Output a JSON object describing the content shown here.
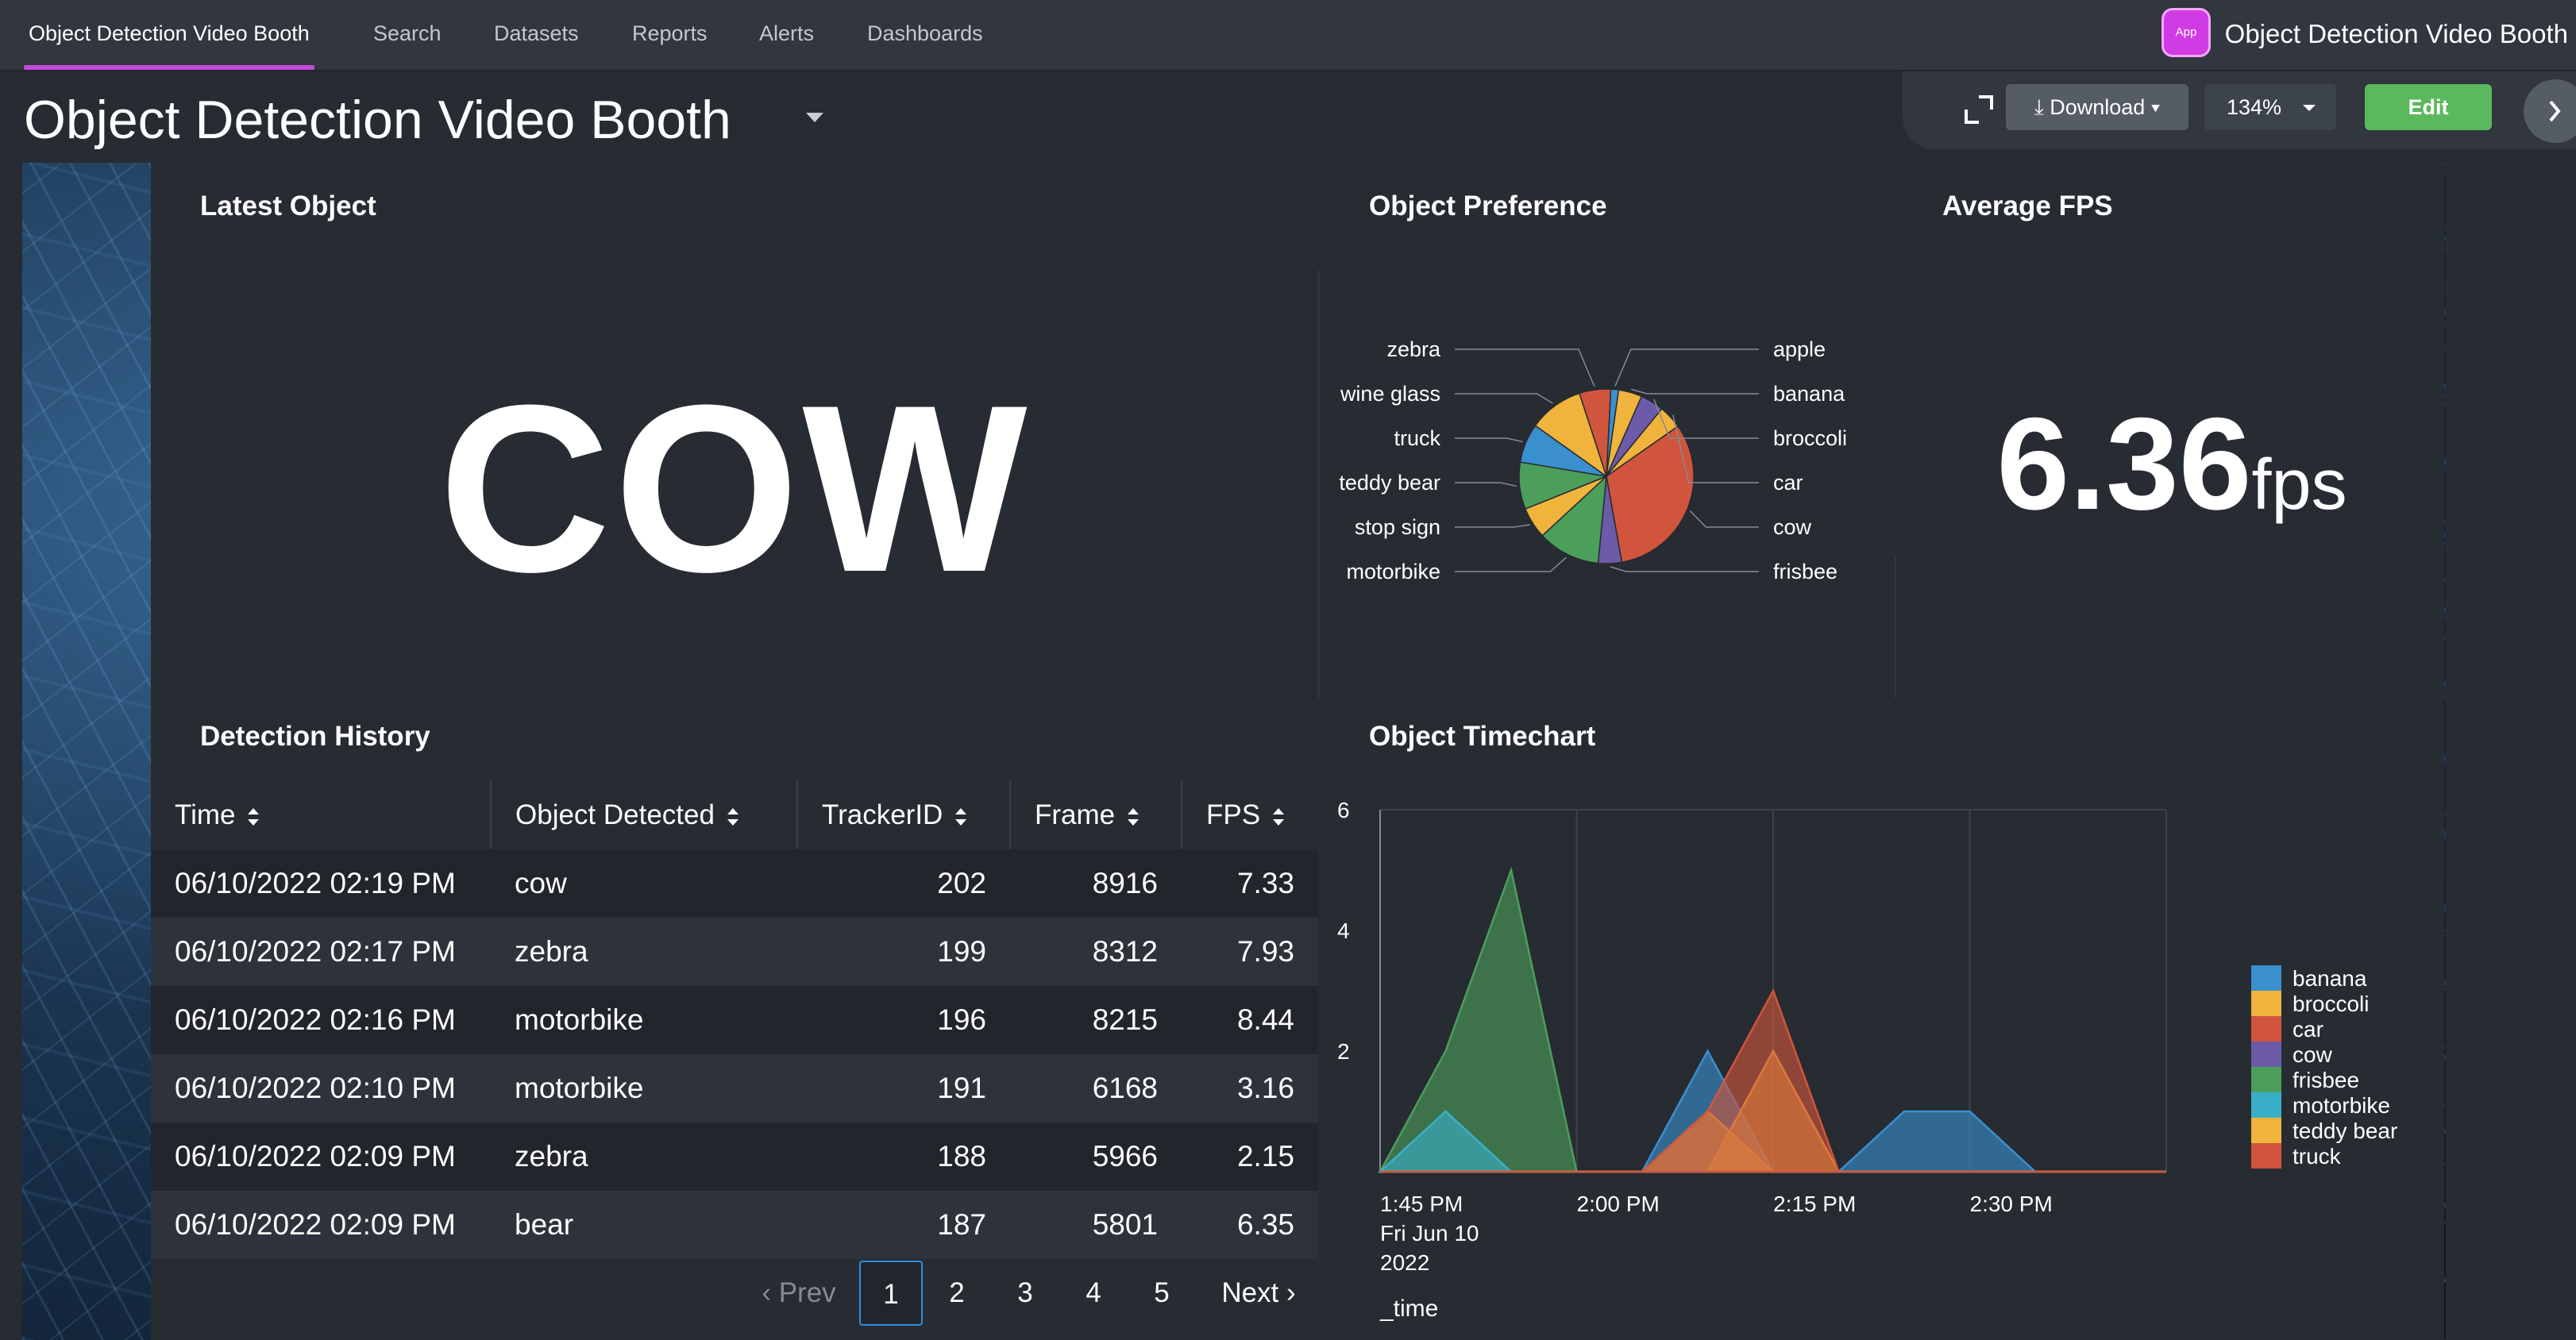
{
  "nav": {
    "tabs": [
      {
        "label": "Object Detection Video Booth",
        "active": true
      },
      {
        "label": "Search"
      },
      {
        "label": "Datasets"
      },
      {
        "label": "Reports"
      },
      {
        "label": "Alerts"
      },
      {
        "label": "Dashboards"
      }
    ],
    "app_badge": "App",
    "app_title": "Object Detection Video Booth",
    "accent_color": "#c34bd9"
  },
  "dashboard": {
    "title": "Object Detection Video Booth",
    "toolbar": {
      "download_label": "⤓ Download ▾",
      "zoom_value": "134%",
      "edit_label": "Edit"
    }
  },
  "latest_object": {
    "title": "Latest Object",
    "value": "COW"
  },
  "object_preference": {
    "title": "Object Preference"
  },
  "average_fps": {
    "title": "Average FPS",
    "value": "6.36",
    "unit": "fps"
  },
  "detection_history": {
    "title": "Detection History",
    "columns": [
      "Time",
      "Object Detected",
      "TrackerID",
      "Frame",
      "FPS"
    ],
    "rows": [
      [
        "06/10/2022 02:19 PM",
        "cow",
        "202",
        "8916",
        "7.33"
      ],
      [
        "06/10/2022 02:17 PM",
        "zebra",
        "199",
        "8312",
        "7.93"
      ],
      [
        "06/10/2022 02:16 PM",
        "motorbike",
        "196",
        "8215",
        "8.44"
      ],
      [
        "06/10/2022 02:10 PM",
        "motorbike",
        "191",
        "6168",
        "3.16"
      ],
      [
        "06/10/2022 02:09 PM",
        "zebra",
        "188",
        "5966",
        "2.15"
      ],
      [
        "06/10/2022 02:09 PM",
        "bear",
        "187",
        "5801",
        "6.35"
      ]
    ],
    "pagination": {
      "prev": "Prev",
      "pages": [
        "1",
        "2",
        "3",
        "4",
        "5"
      ],
      "current": "1",
      "next": "Next"
    }
  },
  "object_timechart": {
    "title": "Object Timechart"
  },
  "chart_data": [
    {
      "type": "pie",
      "title": "Object Preference",
      "slices": [
        {
          "label": "apple",
          "value": 1,
          "color": "#3a8fcf"
        },
        {
          "label": "banana",
          "value": 3,
          "color": "#f0b33b"
        },
        {
          "label": "broccoli",
          "value": 3,
          "color": "#6b5ba8"
        },
        {
          "label": "car",
          "value": 3,
          "color": "#f0b33b"
        },
        {
          "label": "cow",
          "value": 22,
          "color": "#d1553c"
        },
        {
          "label": "frisbee",
          "value": 3,
          "color": "#6b5ba8"
        },
        {
          "label": "motorbike",
          "value": 8,
          "color": "#4c9e5b"
        },
        {
          "label": "stop sign",
          "value": 4,
          "color": "#f0b33b"
        },
        {
          "label": "teddy bear",
          "value": 6,
          "color": "#4c9e5b"
        },
        {
          "label": "truck",
          "value": 5,
          "color": "#3a8fcf"
        },
        {
          "label": "wine glass",
          "value": 7,
          "color": "#f0b33b"
        },
        {
          "label": "zebra",
          "value": 4,
          "color": "#d1553c"
        }
      ]
    },
    {
      "type": "area",
      "title": "Object Timechart",
      "xlabel": "_time",
      "x_ticks": [
        "1:45 PM\nFri Jun 10\n2022",
        "2:00 PM",
        "2:15 PM",
        "2:30 PM"
      ],
      "x_minutes": [
        0,
        5,
        10,
        15,
        20,
        25,
        30,
        35,
        40,
        45,
        50,
        55,
        60
      ],
      "ylim": [
        0,
        6
      ],
      "y_ticks": [
        2,
        4,
        6
      ],
      "grid": true,
      "legend_position": "right",
      "series": [
        {
          "name": "banana",
          "color": "#3a8fcf",
          "values": [
            0,
            0,
            0,
            0,
            0,
            2,
            0,
            0,
            1,
            1,
            0,
            0,
            0
          ]
        },
        {
          "name": "broccoli",
          "color": "#f0b33b",
          "values": [
            0,
            0,
            0,
            0,
            0,
            1,
            0,
            0,
            0,
            0,
            0,
            0,
            0
          ]
        },
        {
          "name": "car",
          "color": "#d1553c",
          "values": [
            0,
            0,
            0,
            0,
            0,
            0,
            0,
            0,
            0,
            0,
            0,
            0,
            0
          ]
        },
        {
          "name": "cow",
          "color": "#6b5ba8",
          "values": [
            0,
            0,
            0,
            0,
            0,
            0,
            0,
            0,
            0,
            0,
            0,
            0,
            0
          ]
        },
        {
          "name": "frisbee",
          "color": "#4c9e5b",
          "values": [
            0,
            2,
            5,
            0,
            0,
            0,
            0,
            0,
            0,
            0,
            0,
            0,
            0
          ]
        },
        {
          "name": "motorbike",
          "color": "#3ab0c8",
          "values": [
            0,
            1,
            0,
            0,
            0,
            0,
            0,
            0,
            0,
            0,
            0,
            0,
            0
          ]
        },
        {
          "name": "teddy bear",
          "color": "#f0b33b",
          "values": [
            0,
            0,
            0,
            0,
            0,
            0,
            2,
            0,
            0,
            0,
            0,
            0,
            0
          ]
        },
        {
          "name": "truck",
          "color": "#d1553c",
          "values": [
            0,
            0,
            0,
            0,
            0,
            1,
            3,
            0,
            0,
            0,
            0,
            0,
            0
          ]
        }
      ]
    }
  ]
}
